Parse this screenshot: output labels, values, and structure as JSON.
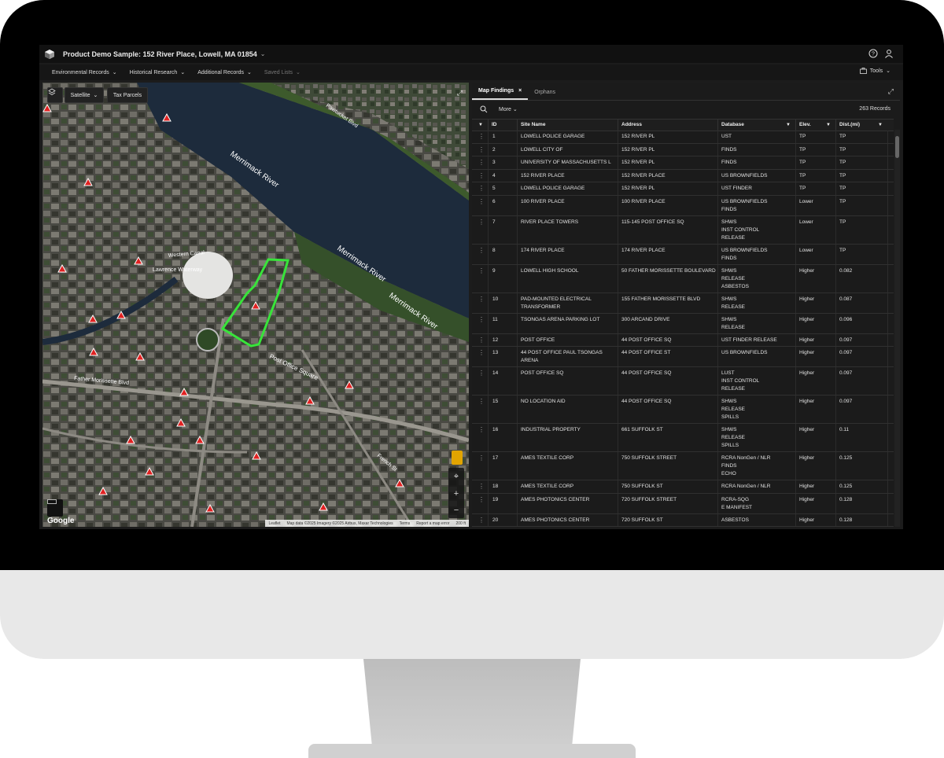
{
  "app": {
    "title": "Product Demo Sample: 152 River Place, Lowell, MA 01854"
  },
  "nav": {
    "items": [
      {
        "label": "Environmental Records"
      },
      {
        "label": "Historical Research"
      },
      {
        "label": "Additional Records"
      },
      {
        "label": "Saved Lists"
      }
    ],
    "tools_label": "Tools"
  },
  "map": {
    "layer_label": "Satellite",
    "parcels_label": "Tax Parcels",
    "labels": {
      "river1": "Merrimack River",
      "river2": "Merrimack River",
      "river3": "Merrimack River",
      "canal": "Western Canal",
      "waterway": "Lawrence Waterway",
      "square": "Post Office Square",
      "street1": "Father Morissette Blvd",
      "street2": "French St",
      "street3": "Pawtucket Blvd"
    },
    "google": "Google",
    "attribution": {
      "leaflet": "Leaflet",
      "mapdata": "Map data ©2025 Imagery ©2025 Airbus, Maxar Technologies",
      "terms": "Terms",
      "report": "Report a map error",
      "scale": "200 ft"
    }
  },
  "panel": {
    "tabs": [
      {
        "label": "Map Findings"
      },
      {
        "label": "Orphans"
      }
    ],
    "more_label": "More",
    "record_count": "263 Records",
    "columns": {
      "id": "ID",
      "site": "Site Name",
      "address": "Address",
      "database": "Database",
      "elev": "Elev.",
      "dist": "Dist.(mi)"
    },
    "rows": [
      {
        "id": "1",
        "site": "LOWELL POLICE GARAGE",
        "address": "152 RIVER PL",
        "database": "UST",
        "elev": "TP",
        "dist": "TP"
      },
      {
        "id": "2",
        "site": "LOWELL CITY OF",
        "address": "152 RIVER PL",
        "database": "FINDS",
        "elev": "TP",
        "dist": "TP"
      },
      {
        "id": "3",
        "site": "UNIVERSITY OF MASSACHUSETTS L",
        "address": "152 RIVER PL",
        "database": "FINDS",
        "elev": "TP",
        "dist": "TP"
      },
      {
        "id": "4",
        "site": "152 RIVER PLACE",
        "address": "152 RIVER PLACE",
        "database": "US BROWNFIELDS",
        "elev": "TP",
        "dist": "TP"
      },
      {
        "id": "5",
        "site": "LOWELL POLICE GARAGE",
        "address": "152 RIVER PL",
        "database": "UST FINDER",
        "elev": "TP",
        "dist": "TP"
      },
      {
        "id": "6",
        "site": "100 RIVER PLACE",
        "address": "100 RIVER PLACE",
        "database": "US BROWNFIELDS\nFINDS",
        "elev": "Lower",
        "dist": "TP"
      },
      {
        "id": "7",
        "site": "RIVER PLACE TOWERS",
        "address": "115-145 POST OFFICE SQ",
        "database": "SHWS\nINST CONTROL\nRELEASE",
        "elev": "Lower",
        "dist": "TP"
      },
      {
        "id": "8",
        "site": "174 RIVER PLACE",
        "address": "174 RIVER PLACE",
        "database": "US BROWNFIELDS\nFINDS",
        "elev": "Lower",
        "dist": "TP"
      },
      {
        "id": "9",
        "site": "LOWELL HIGH SCHOOL",
        "address": "50 FATHER MORISSETTE BOULEVARD",
        "database": "SHWS\nRELEASE\nASBESTOS",
        "elev": "Higher",
        "dist": "0.082"
      },
      {
        "id": "10",
        "site": "PAD-MOUNTED ELECTRICAL\nTRANSFORMER",
        "address": "155 FATHER MORISSETTE BLVD",
        "database": "SHWS\nRELEASE",
        "elev": "Higher",
        "dist": "0.087"
      },
      {
        "id": "11",
        "site": "TSONGAS ARENA PARKING LOT",
        "address": "300 ARCAND DRIVE",
        "database": "SHWS\nRELEASE",
        "elev": "Higher",
        "dist": "0.096"
      },
      {
        "id": "12",
        "site": "POST OFFICE",
        "address": "44 POST OFFICE SQ",
        "database": "UST FINDER RELEASE",
        "elev": "Higher",
        "dist": "0.097"
      },
      {
        "id": "13",
        "site": "44 POST OFFICE PAUL TSONGAS\nARENA",
        "address": "44 POST OFFICE ST",
        "database": "US BROWNFIELDS",
        "elev": "Higher",
        "dist": "0.097"
      },
      {
        "id": "14",
        "site": "POST OFFICE SQ",
        "address": "44 POST OFFICE SQ",
        "database": "LUST\nINST CONTROL\nRELEASE",
        "elev": "Higher",
        "dist": "0.097"
      },
      {
        "id": "15",
        "site": "NO LOCATION AID",
        "address": "44 POST OFFICE SQ",
        "database": "SHWS\nRELEASE\nSPILLS",
        "elev": "Higher",
        "dist": "0.097"
      },
      {
        "id": "16",
        "site": "INDUSTRIAL PROPERTY",
        "address": "661 SUFFOLK ST",
        "database": "SHWS\nRELEASE\nSPILLS",
        "elev": "Higher",
        "dist": "0.11"
      },
      {
        "id": "17",
        "site": "AMES TEXTILE CORP",
        "address": "750 SUFFOLK STREET",
        "database": "RCRA NonGen / NLR\nFINDS\nECHO",
        "elev": "Higher",
        "dist": "0.125"
      },
      {
        "id": "18",
        "site": "AMES TEXTILE CORP",
        "address": "750 SUFFOLK ST",
        "database": "RCRA NonGen / NLR",
        "elev": "Higher",
        "dist": "0.125"
      },
      {
        "id": "19",
        "site": "AMES PHOTONICS CENTER",
        "address": "720 SUFFOLK STREET",
        "database": "RCRA-SQG\nE MANIFEST",
        "elev": "Higher",
        "dist": "0.128"
      },
      {
        "id": "20",
        "site": "AMES PHOTONICS CENTER",
        "address": "720 SUFFOLK ST",
        "database": "ASBESTOS",
        "elev": "Higher",
        "dist": "0.128"
      }
    ]
  }
}
